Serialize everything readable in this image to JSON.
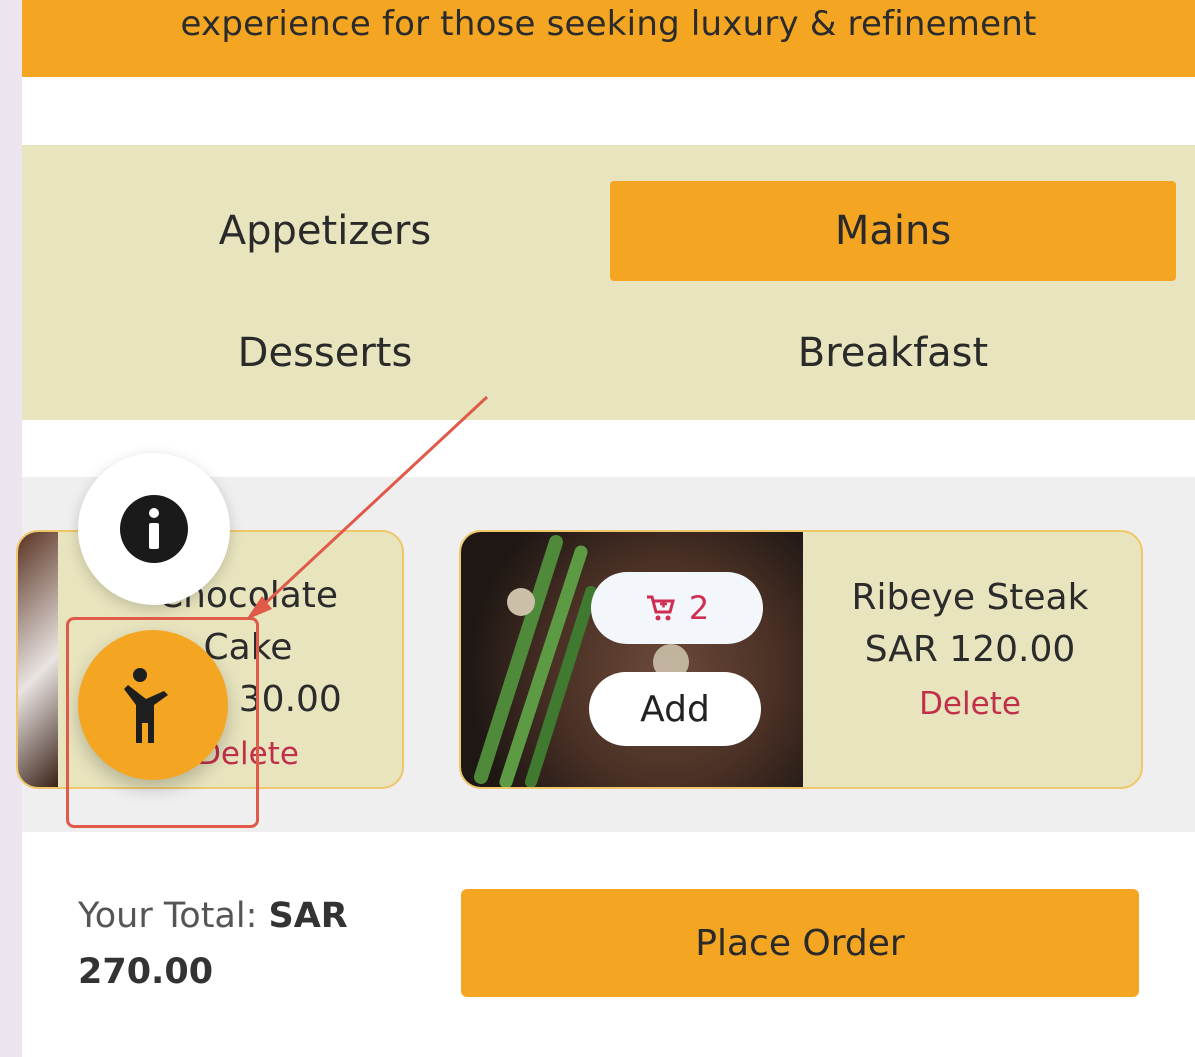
{
  "banner": {
    "text": "experience for those seeking luxury & refinement"
  },
  "tabs": [
    {
      "label": "Appetizers",
      "active": false
    },
    {
      "label": "Mains",
      "active": true
    },
    {
      "label": "Desserts",
      "active": false
    },
    {
      "label": "Breakfast",
      "active": false
    }
  ],
  "products": [
    {
      "name_line1": "Chocolate",
      "name_line2": "Cake",
      "price": "SAR 30.00",
      "delete_label": "Delete"
    },
    {
      "name": "Ribeye Steak",
      "price": "SAR 120.00",
      "delete_label": "Delete",
      "cart_count": "2",
      "add_label": "Add"
    }
  ],
  "footer": {
    "total_label": "Your Total:",
    "total_currency": "SAR",
    "total_amount": "270.00",
    "place_order_label": "Place Order"
  },
  "floating": {
    "info_icon": "info-icon",
    "accessibility_icon": "accessibility-person-icon"
  },
  "colors": {
    "accent": "#f4a623",
    "panel": "#e8e4be",
    "danger": "#c0304a",
    "annotation": "#e05a4a"
  }
}
